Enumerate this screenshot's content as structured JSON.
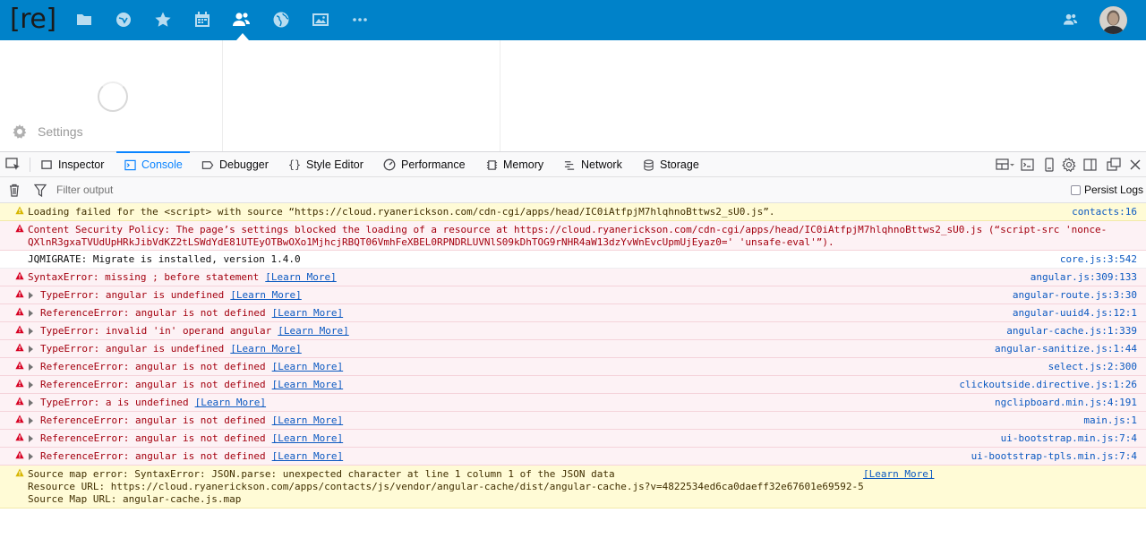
{
  "app": {
    "logo_text": "[re]",
    "nav_icons": [
      "files-icon",
      "activity-icon",
      "favorites-icon",
      "calendar-icon",
      "contacts-icon",
      "social-icon",
      "gallery-icon",
      "more-icon"
    ],
    "active_nav": "contacts-icon",
    "brand_color": "#0082c9"
  },
  "sidebar": {
    "settings_label": "Settings"
  },
  "devtools": {
    "tabs": [
      {
        "label": "Inspector",
        "icon": "inspector-icon"
      },
      {
        "label": "Console",
        "icon": "console-icon",
        "active": true
      },
      {
        "label": "Debugger",
        "icon": "debugger-icon"
      },
      {
        "label": "Style Editor",
        "icon": "style-editor-icon"
      },
      {
        "label": "Performance",
        "icon": "performance-icon"
      },
      {
        "label": "Memory",
        "icon": "memory-icon"
      },
      {
        "label": "Network",
        "icon": "network-icon"
      },
      {
        "label": "Storage",
        "icon": "storage-icon"
      }
    ],
    "filter_placeholder": "Filter output",
    "persist_logs_label": "Persist Logs",
    "learn_more": "[Learn More]"
  },
  "console": {
    "messages": [
      {
        "level": "warn",
        "text": "Loading failed for the <script> with source “https://cloud.ryanerickson.com/cdn-cgi/apps/head/IC0iAtfpjM7hlqhnoBttws2_sU0.js”.",
        "location": "contacts:16"
      },
      {
        "level": "err",
        "text": "Content Security Policy: The page’s settings blocked the loading of a resource at https://cloud.ryanerickson.com/cdn-cgi/apps/head/IC0iAtfpjM7hlqhnoBttws2_sU0.js (“script-src 'nonce-\nQXlnR3gxaTVUdUpHRkJibVdKZ2tLSWdYdE81UTEyOTBwOXo1MjhcjRBQT06VmhFeXBEL0RPNDRLUVNlS09kDhTOG9rNHR4aW13dzYvWnEvcUpmUjEyaz0=' 'unsafe-eval'”).",
        "location": ""
      },
      {
        "level": "log",
        "text": "JQMIGRATE: Migrate is installed, version 1.4.0",
        "location": "core.js:3:542"
      },
      {
        "level": "err",
        "text": "SyntaxError: missing ; before statement",
        "learn": true,
        "location": "angular.js:309:133"
      },
      {
        "level": "err",
        "twisty": true,
        "text": "TypeError: angular is undefined",
        "learn": true,
        "location": "angular-route.js:3:30"
      },
      {
        "level": "err",
        "twisty": true,
        "text": "ReferenceError: angular is not defined",
        "learn": true,
        "location": "angular-uuid4.js:12:1"
      },
      {
        "level": "err",
        "twisty": true,
        "text": "TypeError: invalid 'in' operand angular",
        "learn": true,
        "location": "angular-cache.js:1:339"
      },
      {
        "level": "err",
        "twisty": true,
        "text": "TypeError: angular is undefined",
        "learn": true,
        "location": "angular-sanitize.js:1:44"
      },
      {
        "level": "err",
        "twisty": true,
        "text": "ReferenceError: angular is not defined",
        "learn": true,
        "location": "select.js:2:300"
      },
      {
        "level": "err",
        "twisty": true,
        "text": "ReferenceError: angular is not defined",
        "learn": true,
        "location": "clickoutside.directive.js:1:26"
      },
      {
        "level": "err",
        "twisty": true,
        "text": "TypeError: a is undefined",
        "learn": true,
        "location": "ngclipboard.min.js:4:191"
      },
      {
        "level": "err",
        "twisty": true,
        "text": "ReferenceError: angular is not defined",
        "learn": true,
        "location": "main.js:1"
      },
      {
        "level": "err",
        "twisty": true,
        "text": "ReferenceError: angular is not defined",
        "learn": true,
        "location": "ui-bootstrap.min.js:7:4"
      },
      {
        "level": "err",
        "twisty": true,
        "text": "ReferenceError: angular is not defined",
        "learn": true,
        "location": "ui-bootstrap-tpls.min.js:7:4"
      },
      {
        "level": "warn",
        "text": "Source map error: SyntaxError: JSON.parse: unexpected character at line 1 column 1 of the JSON data\nResource URL: https://cloud.ryanerickson.com/apps/contacts/js/vendor/angular-cache/dist/angular-cache.js?v=4822534ed6ca0daeff32e67601e69592-5\nSource Map URL: angular-cache.js.map",
        "learn_inline": true,
        "location": ""
      }
    ]
  },
  "colors": {
    "error_bg": "#fdf2f5",
    "error_text": "#a4000f",
    "warn_bg": "#fffbd6",
    "link": "#0b59c1",
    "devtools_accent": "#0a84ff"
  }
}
